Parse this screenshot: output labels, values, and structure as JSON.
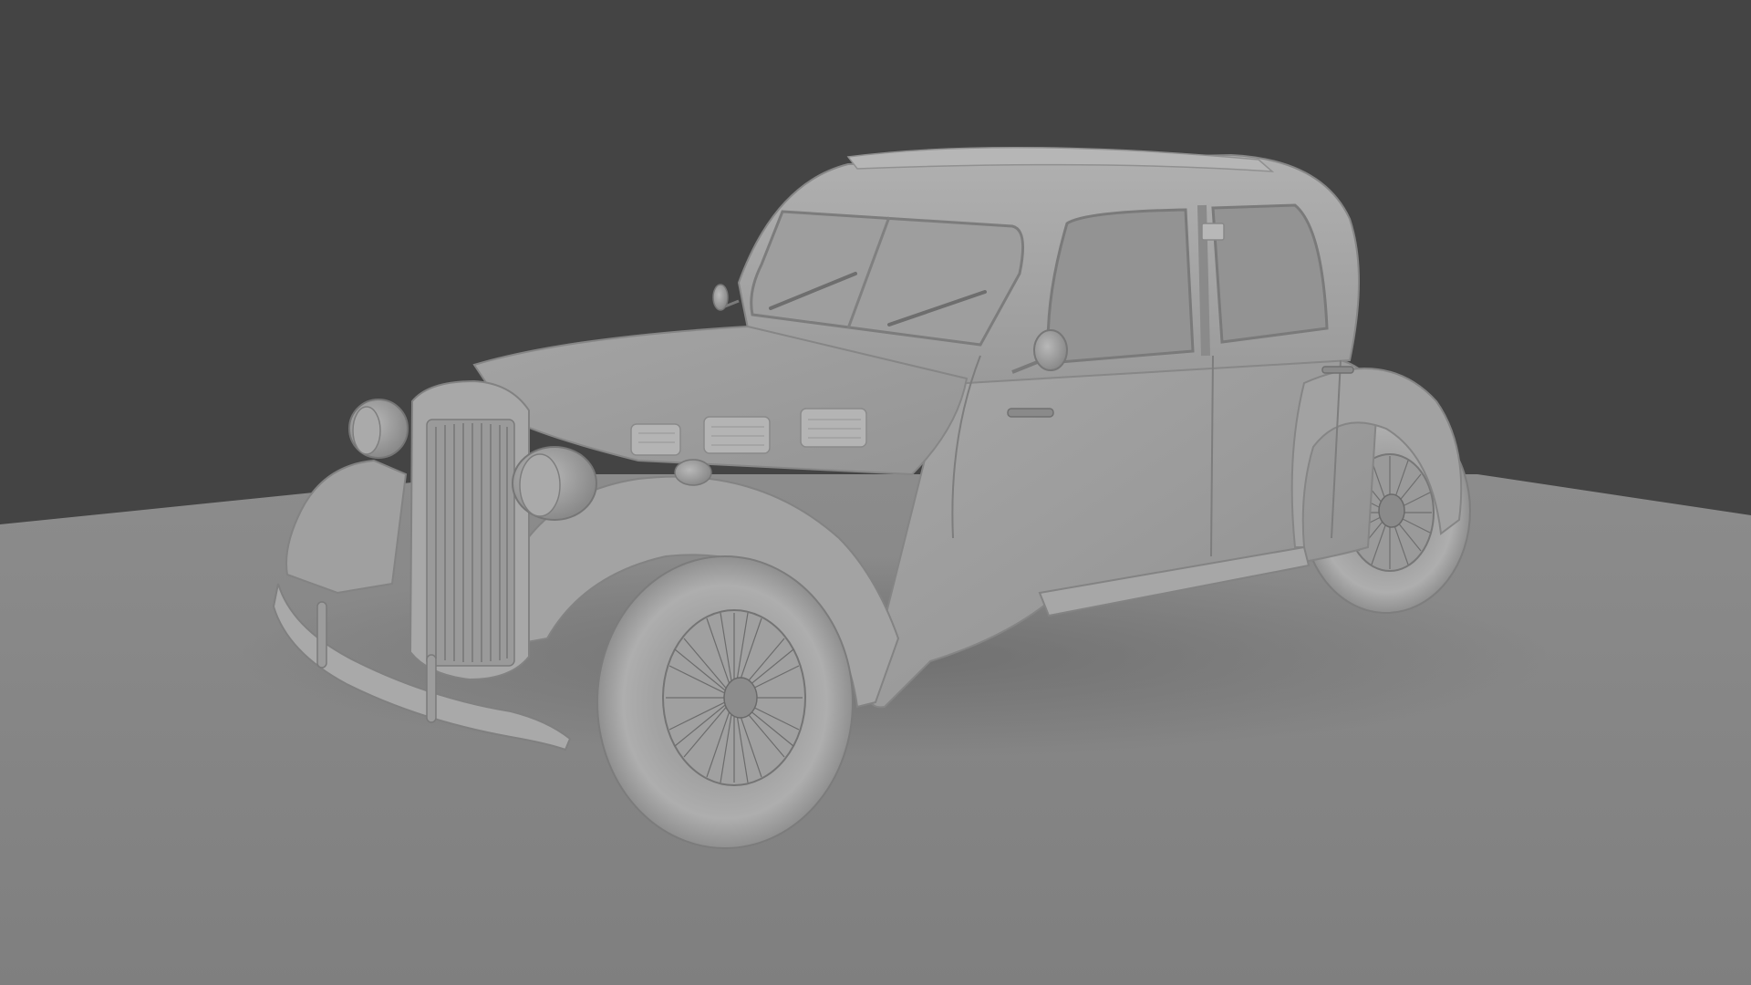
{
  "scene": {
    "background_color": "#444444",
    "floor_color": "#8a8a8a",
    "model_base_color": "#9c9c9c",
    "model": "vintage-sedan-clay-render"
  }
}
